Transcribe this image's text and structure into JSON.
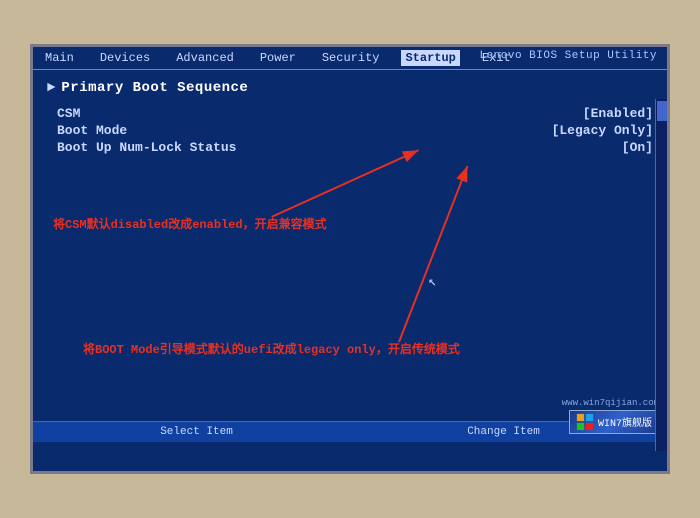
{
  "brand": "Lenovo BIOS Setup Utility",
  "menu": {
    "items": [
      {
        "label": "Main",
        "active": false
      },
      {
        "label": "Devices",
        "active": false
      },
      {
        "label": "Advanced",
        "active": false
      },
      {
        "label": "Power",
        "active": false
      },
      {
        "label": "Security",
        "active": false
      },
      {
        "label": "Startup",
        "active": true
      },
      {
        "label": "Exit",
        "active": false
      }
    ]
  },
  "section": {
    "title": "Primary Boot Sequence"
  },
  "items": [
    {
      "label": "CSM",
      "value": "[Enabled]"
    },
    {
      "label": "Boot Mode",
      "value": "[Legacy Only]"
    },
    {
      "label": "Boot Up Num-Lock Status",
      "value": "[On]"
    }
  ],
  "annotation1": "将CSM默认disabled改成enabled，开启兼容模式",
  "annotation2": "将BOOT Mode引导模式默认的uefi改成legacy only，开启传统模式",
  "bottom": {
    "items": [
      {
        "label": "Select Item"
      },
      {
        "label": "Change Item"
      }
    ]
  },
  "watermark": {
    "url": "www.win7qijian.com",
    "badge": "WIN7旗舰版"
  },
  "colors": {
    "bios_bg": "#0a2a6e",
    "text": "#c8d8ff",
    "active_tab_bg": "#c8d8ff",
    "active_tab_text": "#0a1060",
    "arrow_red": "#e83020"
  }
}
